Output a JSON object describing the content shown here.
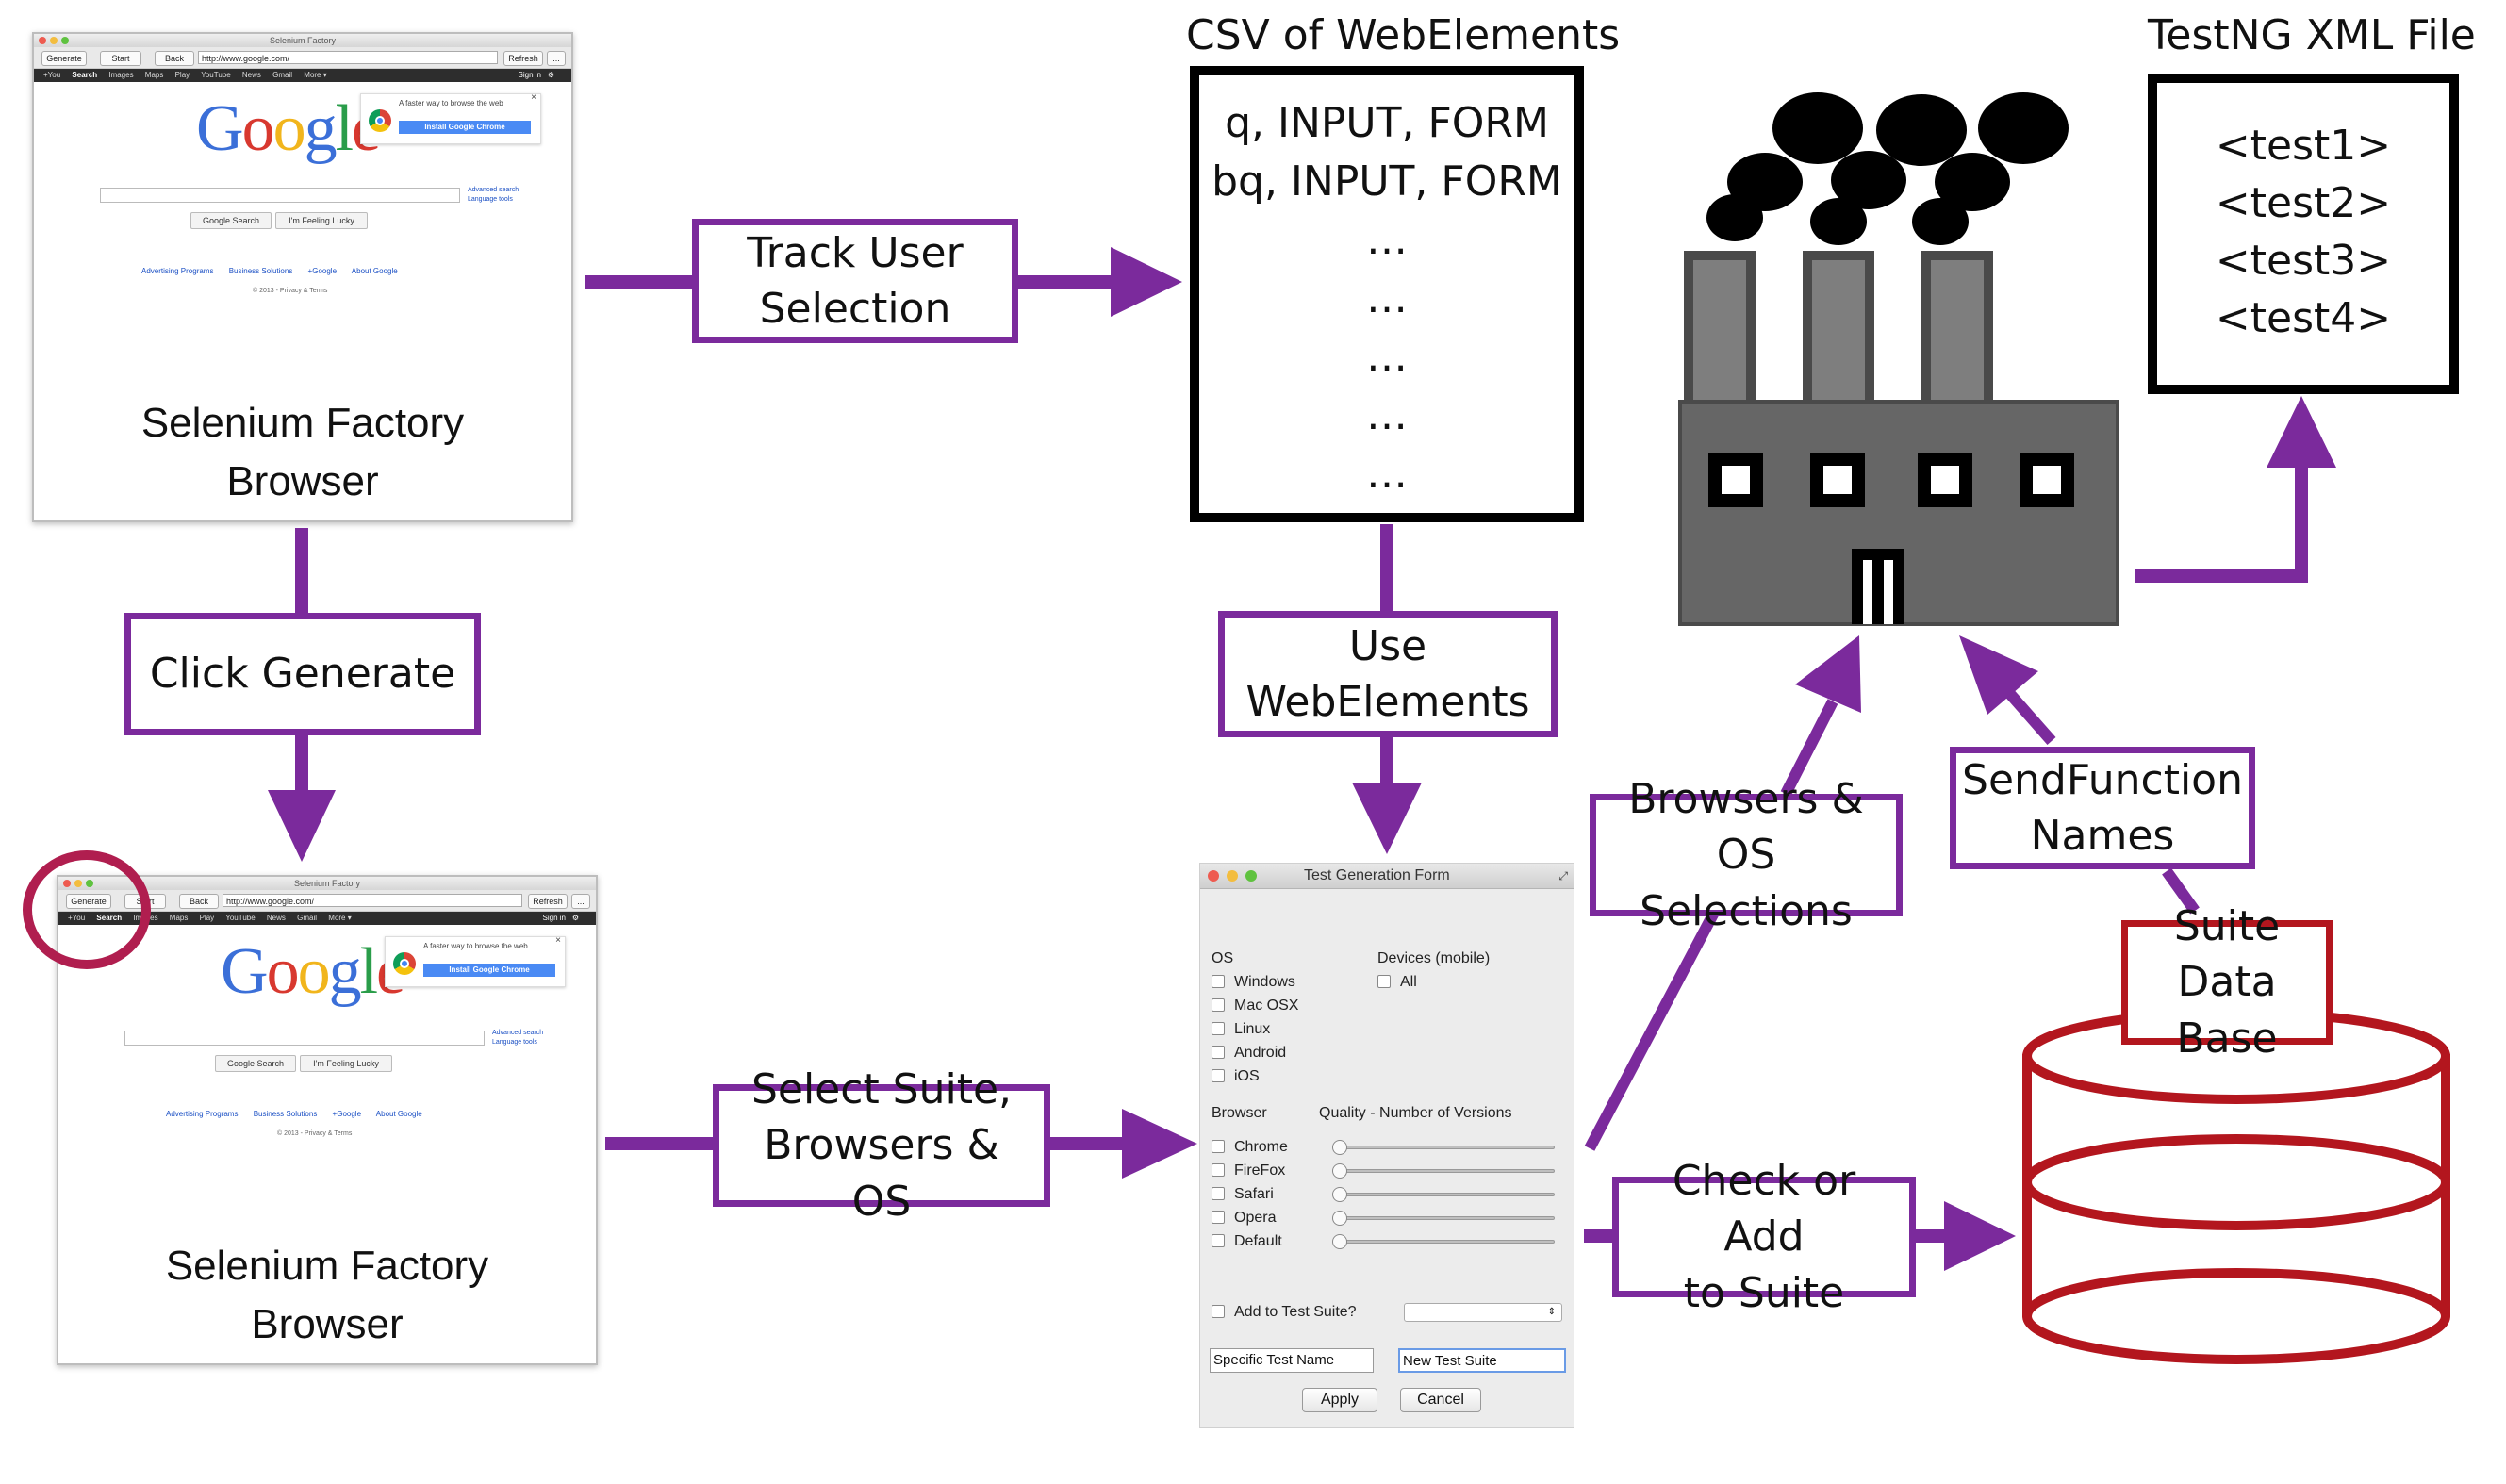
{
  "browser": {
    "window_title": "Selenium Factory",
    "toolbar": {
      "generate_label": "Generate",
      "start_label": "Start",
      "back_label": "Back",
      "url": "http://www.google.com/",
      "refresh_label": "Refresh",
      "more_label": "..."
    },
    "google_bar": {
      "items": [
        "+You",
        "Search",
        "Images",
        "Maps",
        "Play",
        "YouTube",
        "News",
        "Gmail",
        "More ▾"
      ],
      "sign_in": "Sign in"
    },
    "logo_text": "Google",
    "promo": {
      "text": "A faster way to browse the web",
      "button": "Install Google Chrome"
    },
    "search_links": [
      "Advanced search",
      "Language tools"
    ],
    "buttons": [
      "Google Search",
      "I'm Feeling Lucky"
    ],
    "footer_links": [
      "Advertising Programs",
      "Business Solutions",
      "+Google",
      "About Google"
    ],
    "copyright": "© 2013 - Privacy & Terms"
  },
  "nodes": {
    "browser_top_caption": "Selenium Factory\nBrowser",
    "browser_bottom_caption": "Selenium Factory\nBrowser",
    "track_user_selection": "Track User\nSelection",
    "click_generate": "Click Generate",
    "use_webelements": "Use\nWebElements",
    "select_suite": "Select Suite,\nBrowsers & OS",
    "browsers_os": "Browsers & OS\nSelections",
    "send_function": "SendFunction\nNames",
    "check_or_add": "Check or Add\nto Suite",
    "suite_db": "Suite\nData Base"
  },
  "csv": {
    "title": "CSV of WebElements",
    "lines": [
      "q, INPUT, FORM",
      "bq, INPUT, FORM",
      "…",
      "…",
      "…",
      "…",
      "…"
    ]
  },
  "testng": {
    "title": "TestNG XML File",
    "lines": [
      "<test1>",
      "<test2>",
      "<test3>",
      "<test4>"
    ]
  },
  "form": {
    "title": "Test Generation Form",
    "os_heading": "OS",
    "os_options": [
      "Windows",
      "Mac OSX",
      "Linux",
      "Android",
      "iOS"
    ],
    "devices_heading": "Devices (mobile)",
    "devices_options": [
      "All"
    ],
    "browser_heading": "Browser",
    "quality_heading": "Quality - Number of Versions",
    "browsers": [
      "Chrome",
      "FireFox",
      "Safari",
      "Opera",
      "Default"
    ],
    "add_to_suite": "Add to Test Suite?",
    "specific_name_placeholder": "Specific Test Name",
    "new_suite_value": "New Test Suite",
    "apply": "Apply",
    "cancel": "Cancel"
  },
  "colors": {
    "flow": "#7b2a9c",
    "database": "#b3161e",
    "highlight_circle": "#b01e4f",
    "factory_body": "#666666"
  },
  "icons": {
    "factory": "factory-icon",
    "database": "database-cylinder-icon",
    "generate_highlight": "circle-highlight"
  }
}
